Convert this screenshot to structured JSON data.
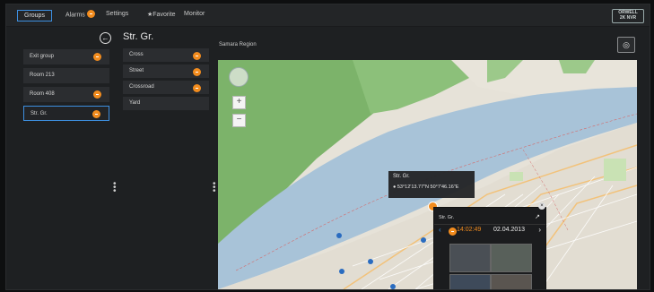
{
  "nav": {
    "groups": "Groups",
    "alarms": "Alarms",
    "settings": "Settings",
    "favorite": "★Favorite",
    "monitor": "Monitor"
  },
  "logo": {
    "line1": "ORWELL",
    "line2": "2K NVR"
  },
  "panel_title": "Str. Gr.",
  "region_title": "Samara Region",
  "groups_list": [
    {
      "label": "Exit group",
      "badge": true
    },
    {
      "label": "Room 213",
      "badge": false
    },
    {
      "label": "Room 408",
      "badge": true
    },
    {
      "label": "Str. Gr.",
      "badge": true,
      "selected": true
    }
  ],
  "subgroups_list": [
    {
      "label": "Cross",
      "badge": true
    },
    {
      "label": "Street",
      "badge": true
    },
    {
      "label": "Crossroad",
      "badge": true
    },
    {
      "label": "Yard",
      "badge": false
    }
  ],
  "tooltip": {
    "title": "Str. Gr.",
    "coords": "53°12'13.77\"N 50°7'46.16\"E"
  },
  "camera_popup": {
    "name": "Str. Gr.",
    "time": "14:02:49",
    "date": "02.04.2013"
  },
  "colors": {
    "accent": "#3d8fe0",
    "badge": "#f28c1e",
    "water": "#a8c3d8",
    "forest": "#7bb36a"
  }
}
